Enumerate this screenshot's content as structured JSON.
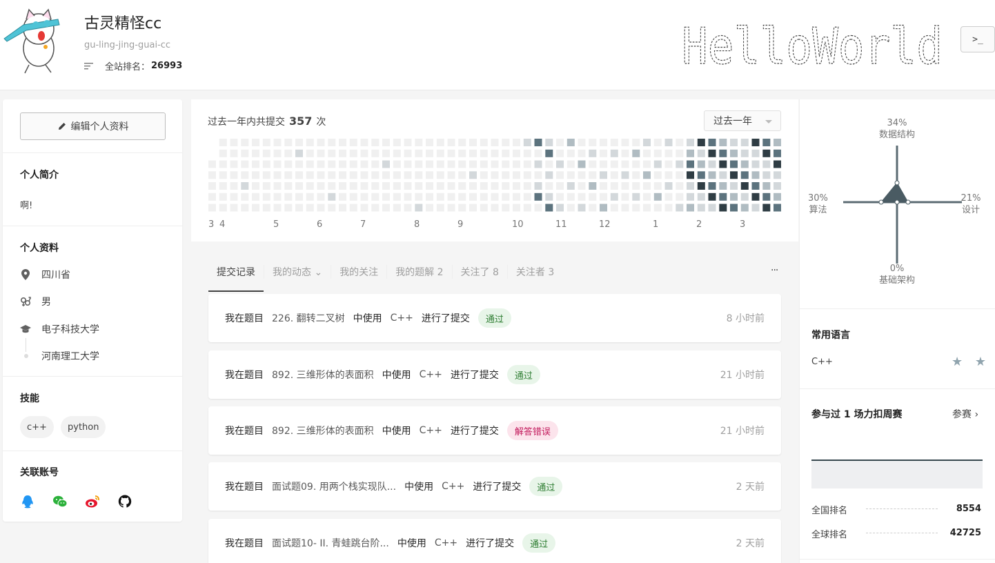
{
  "user": {
    "name": "古灵精怪cc",
    "slug": "gu-ling-jing-guai-cc",
    "rank_label": "全站排名：",
    "rank_value": "26993",
    "terminal_label": ">_"
  },
  "banner_ascii_text": "HelloWorld",
  "sidebar": {
    "edit_button": "编辑个人资料",
    "bio_title": "个人简介",
    "bio_text": "啊!",
    "profile_title": "个人资料",
    "location": "四川省",
    "gender": "男",
    "school_1": "电子科技大学",
    "school_2": "河南理工大学",
    "skills_title": "技能",
    "skills": [
      "c++",
      "python"
    ],
    "linked_title": "关联账号",
    "linked_icons": [
      "qq-icon",
      "wechat-icon",
      "weibo-icon",
      "github-icon"
    ]
  },
  "heatmap": {
    "title_prefix": "过去一年内共提交",
    "count": "357",
    "title_suffix": "次",
    "range_select": "过去一年",
    "months": [
      "3",
      "4",
      "5",
      "6",
      "7",
      "8",
      "9",
      "10",
      "11",
      "12",
      "1",
      "2",
      "3"
    ],
    "colors": [
      "#f0f0f0",
      "#d3d8db",
      "#b0bcc2",
      "#5c737e",
      "#2f3d44"
    ]
  },
  "tabs": [
    {
      "label": "提交记录"
    },
    {
      "label": "我的动态 ⌄"
    },
    {
      "label": "我的关注"
    },
    {
      "label": "我的题解 2"
    },
    {
      "label": "关注了 8"
    },
    {
      "label": "关注者 3"
    }
  ],
  "more_label": "···",
  "submissions": [
    {
      "prefix": "我在题目",
      "problem": "226. 翻转二叉树",
      "using": "中使用",
      "lang": "C++",
      "action": "进行了提交",
      "result": "通过",
      "status": "ok",
      "time": "8 小时前"
    },
    {
      "prefix": "我在题目",
      "problem": "892. 三维形体的表面积",
      "using": "中使用",
      "lang": "C++",
      "action": "进行了提交",
      "result": "通过",
      "status": "ok",
      "time": "21 小时前"
    },
    {
      "prefix": "我在题目",
      "problem": "892. 三维形体的表面积",
      "using": "中使用",
      "lang": "C++",
      "action": "进行了提交",
      "result": "解答错误",
      "status": "err",
      "time": "21 小时前"
    },
    {
      "prefix": "我在题目",
      "problem": "面试题09. 用两个栈实现队...",
      "using": "中使用",
      "lang": "C++",
      "action": "进行了提交",
      "result": "通过",
      "status": "ok",
      "time": "2 天前"
    },
    {
      "prefix": "我在题目",
      "problem": "面试题10- II. 青蛙跳台阶...",
      "using": "中使用",
      "lang": "C++",
      "action": "进行了提交",
      "result": "通过",
      "status": "ok",
      "time": "2 天前"
    }
  ],
  "radar": {
    "top": {
      "pct": "34%",
      "name": "数据结构"
    },
    "left": {
      "pct": "30%",
      "name": "算法"
    },
    "right": {
      "pct": "21%",
      "name": "设计"
    },
    "bottom": {
      "pct": "0%",
      "name": "基础架构"
    }
  },
  "languages": {
    "title": "常用语言",
    "items": [
      {
        "name": "C++",
        "stars": "★ ★"
      }
    ]
  },
  "contest": {
    "title": "参与过 1 场力扣周赛",
    "link": "参赛 ›",
    "national_label": "全国排名",
    "national_value": "8554",
    "global_label": "全球排名",
    "global_value": "42725"
  }
}
